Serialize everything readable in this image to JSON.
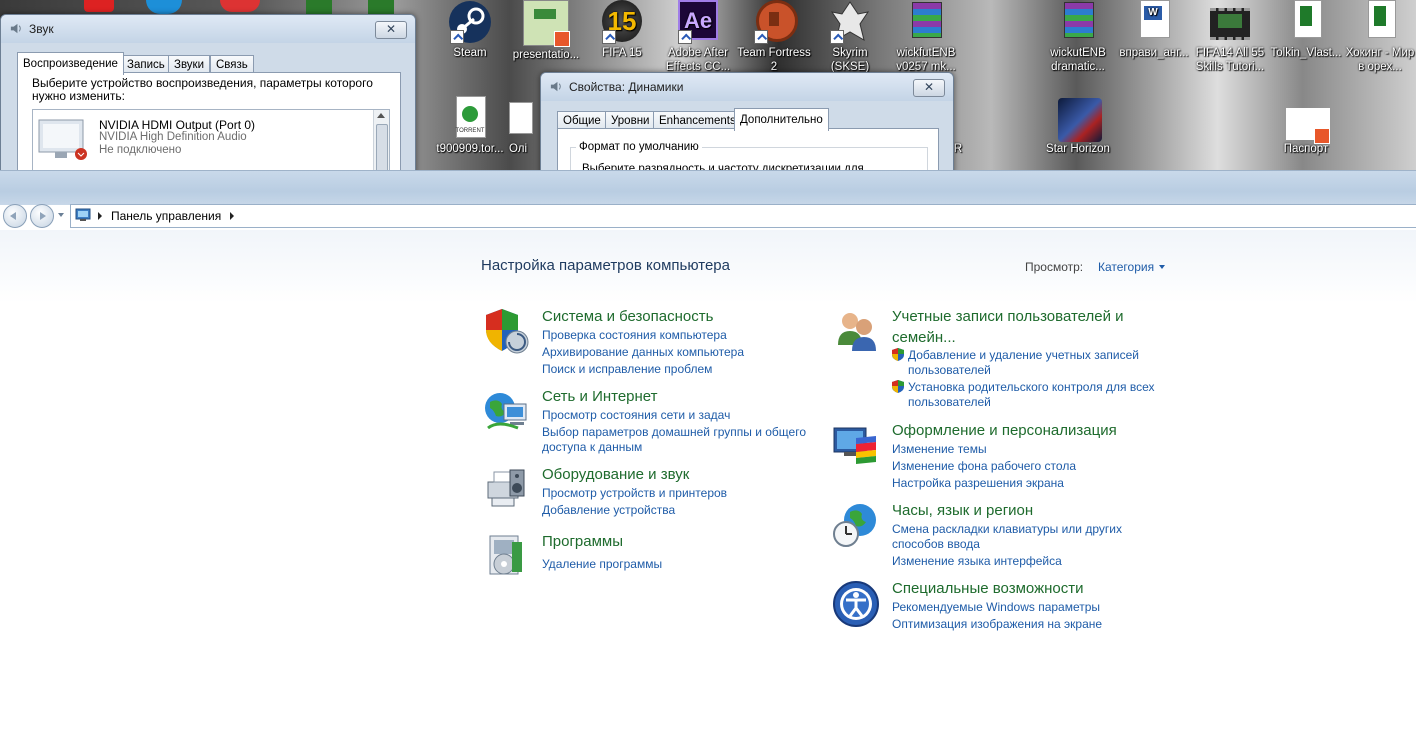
{
  "desktop": {
    "icons": [
      {
        "label": "Steam"
      },
      {
        "label": "presentatio..."
      },
      {
        "label": "FIFA 15"
      },
      {
        "label": "Adobe After Effects CC..."
      },
      {
        "label": "Team Fortress 2"
      },
      {
        "label": "Skyrim (SKSE)"
      },
      {
        "label": "wickfutENB v0257 mk..."
      },
      {
        "label": "wickutENB dramatic..."
      },
      {
        "label": "вправи_анг..."
      },
      {
        "label": "FIFA14 All 55 Skills Tutori..."
      },
      {
        "label": "Tolkin_Vlast..."
      },
      {
        "label": "Хокинг - Мир в орех..."
      },
      {
        "label": "t900909.tor..."
      },
      {
        "label": "Олі"
      },
      {
        "label": "R"
      },
      {
        "label": "Star Horizon"
      },
      {
        "label": "Паспорт"
      },
      {
        "label": "TORRENT"
      },
      {
        "label": "Ae"
      }
    ]
  },
  "sound_window": {
    "title": "Звук",
    "close": "✕",
    "tabs": [
      "Воспроизведение",
      "Запись",
      "Звуки",
      "Связь"
    ],
    "instruction": "Выберите устройство воспроизведения, параметры которого нужно изменить:",
    "device": {
      "name": "NVIDIA HDMI Output (Port 0)",
      "driver": "NVIDIA High Definition Audio",
      "status": "Не подключено"
    }
  },
  "props_window": {
    "title": "Свойства: Динамики",
    "close": "✕",
    "tabs": [
      "Общие",
      "Уровни",
      "Enhancements",
      "Дополнительно"
    ],
    "group_title": "Формат по умолчанию",
    "group_text": "Выберите разрядность и частоту дискретизации для"
  },
  "explorer": {
    "breadcrumb": "Панель управления",
    "heading": "Настройка параметров компьютера",
    "view_label": "Просмотр:",
    "view_value": "Категория",
    "left": [
      {
        "title": "Система и безопасность",
        "links": [
          "Проверка состояния компьютера",
          "Архивирование данных компьютера",
          "Поиск и исправление проблем"
        ]
      },
      {
        "title": "Сеть и Интернет",
        "links": [
          "Просмотр состояния сети и задач",
          "Выбор параметров домашней группы и общего",
          "доступа к данным"
        ]
      },
      {
        "title": "Оборудование и звук",
        "links": [
          "Просмотр устройств и принтеров",
          "Добавление устройства"
        ]
      },
      {
        "title": "Программы",
        "links": [
          "Удаление программы"
        ]
      }
    ],
    "right": [
      {
        "title": "Учетные записи пользователей и",
        "title2": "семейн...",
        "links": [
          "Добавление и удаление учетных записей",
          "пользователей",
          "Установка родительского контроля для всех",
          "пользователей"
        ]
      },
      {
        "title": "Оформление и персонализация",
        "links": [
          "Изменение темы",
          "Изменение фона рабочего стола",
          "Настройка разрешения экрана"
        ]
      },
      {
        "title": "Часы, язык и регион",
        "links": [
          "Смена раскладки клавиатуры или других",
          "способов ввода",
          "Изменение языка интерфейса"
        ]
      },
      {
        "title": "Специальные возможности",
        "links": [
          "Рекомендуемые Windows параметры",
          "Оптимизация изображения на экране"
        ]
      }
    ]
  }
}
